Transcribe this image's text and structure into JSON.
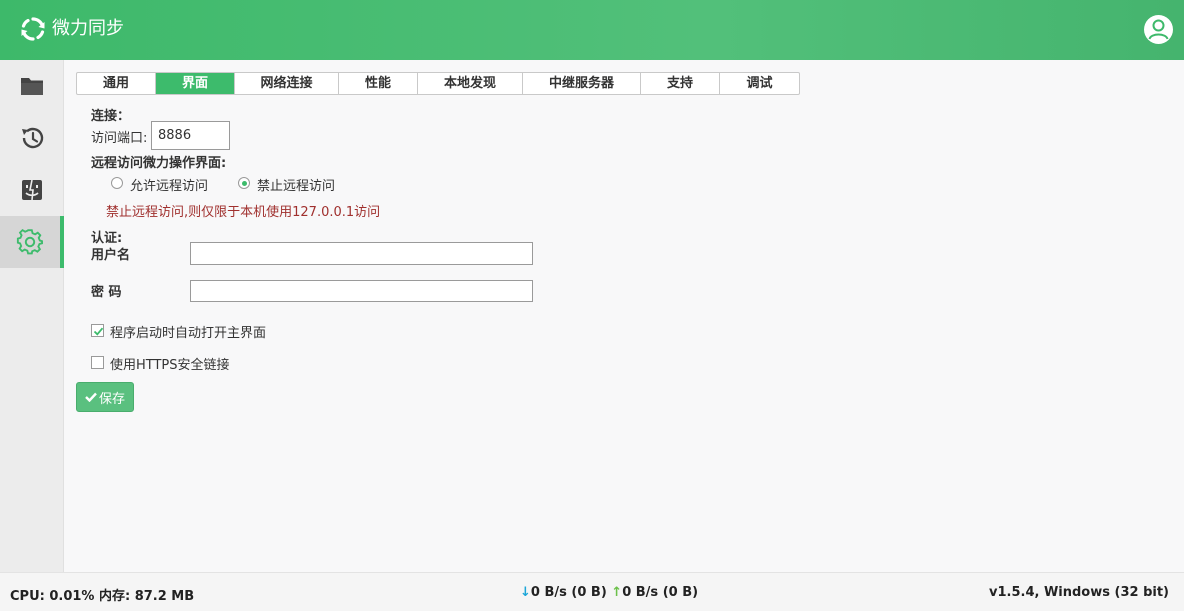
{
  "header": {
    "title": "微力同步",
    "logo_icon": "sync-icon",
    "user_icon": "user-avatar-icon"
  },
  "sidebar": {
    "items": [
      {
        "name": "folders",
        "icon": "folder-icon"
      },
      {
        "name": "history",
        "icon": "history-icon"
      },
      {
        "name": "devices",
        "icon": "finder-icon"
      },
      {
        "name": "settings",
        "icon": "gear-icon",
        "active": true
      }
    ]
  },
  "tabs": [
    {
      "label": "通用"
    },
    {
      "label": "界面",
      "active": true
    },
    {
      "label": "网络连接"
    },
    {
      "label": "性能"
    },
    {
      "label": "本地发现"
    },
    {
      "label": "中继服务器"
    },
    {
      "label": "支持"
    },
    {
      "label": "调试"
    }
  ],
  "form": {
    "connection_label": "连接：",
    "port_label": "访问端口:",
    "port_value": "8886",
    "remote_label": "远程访问微力操作界面:",
    "allow_remote": "允许远程访问",
    "deny_remote": "禁止远程访问",
    "remote_selected": "deny",
    "warning": "禁止远程访问,则仅限于本机使用127.0.0.1访问",
    "auth_label": "认证:",
    "username_label": "用户名",
    "username_value": "",
    "password_label": "密 码",
    "password_value": "",
    "auto_open_label": "程序启动时自动打开主界面",
    "auto_open_checked": true,
    "https_label": "使用HTTPS安全链接",
    "https_checked": false,
    "save_label": "保存"
  },
  "status": {
    "cpu": "CPU: 0.01% 内存: 87.2 MB",
    "down": "0 B/s (0 B)",
    "up": "0 B/s (0 B)",
    "version": "v1.5.4, Windows (32 bit)"
  },
  "colors": {
    "accent": "#3dbb6c",
    "warning": "#a0302e"
  }
}
